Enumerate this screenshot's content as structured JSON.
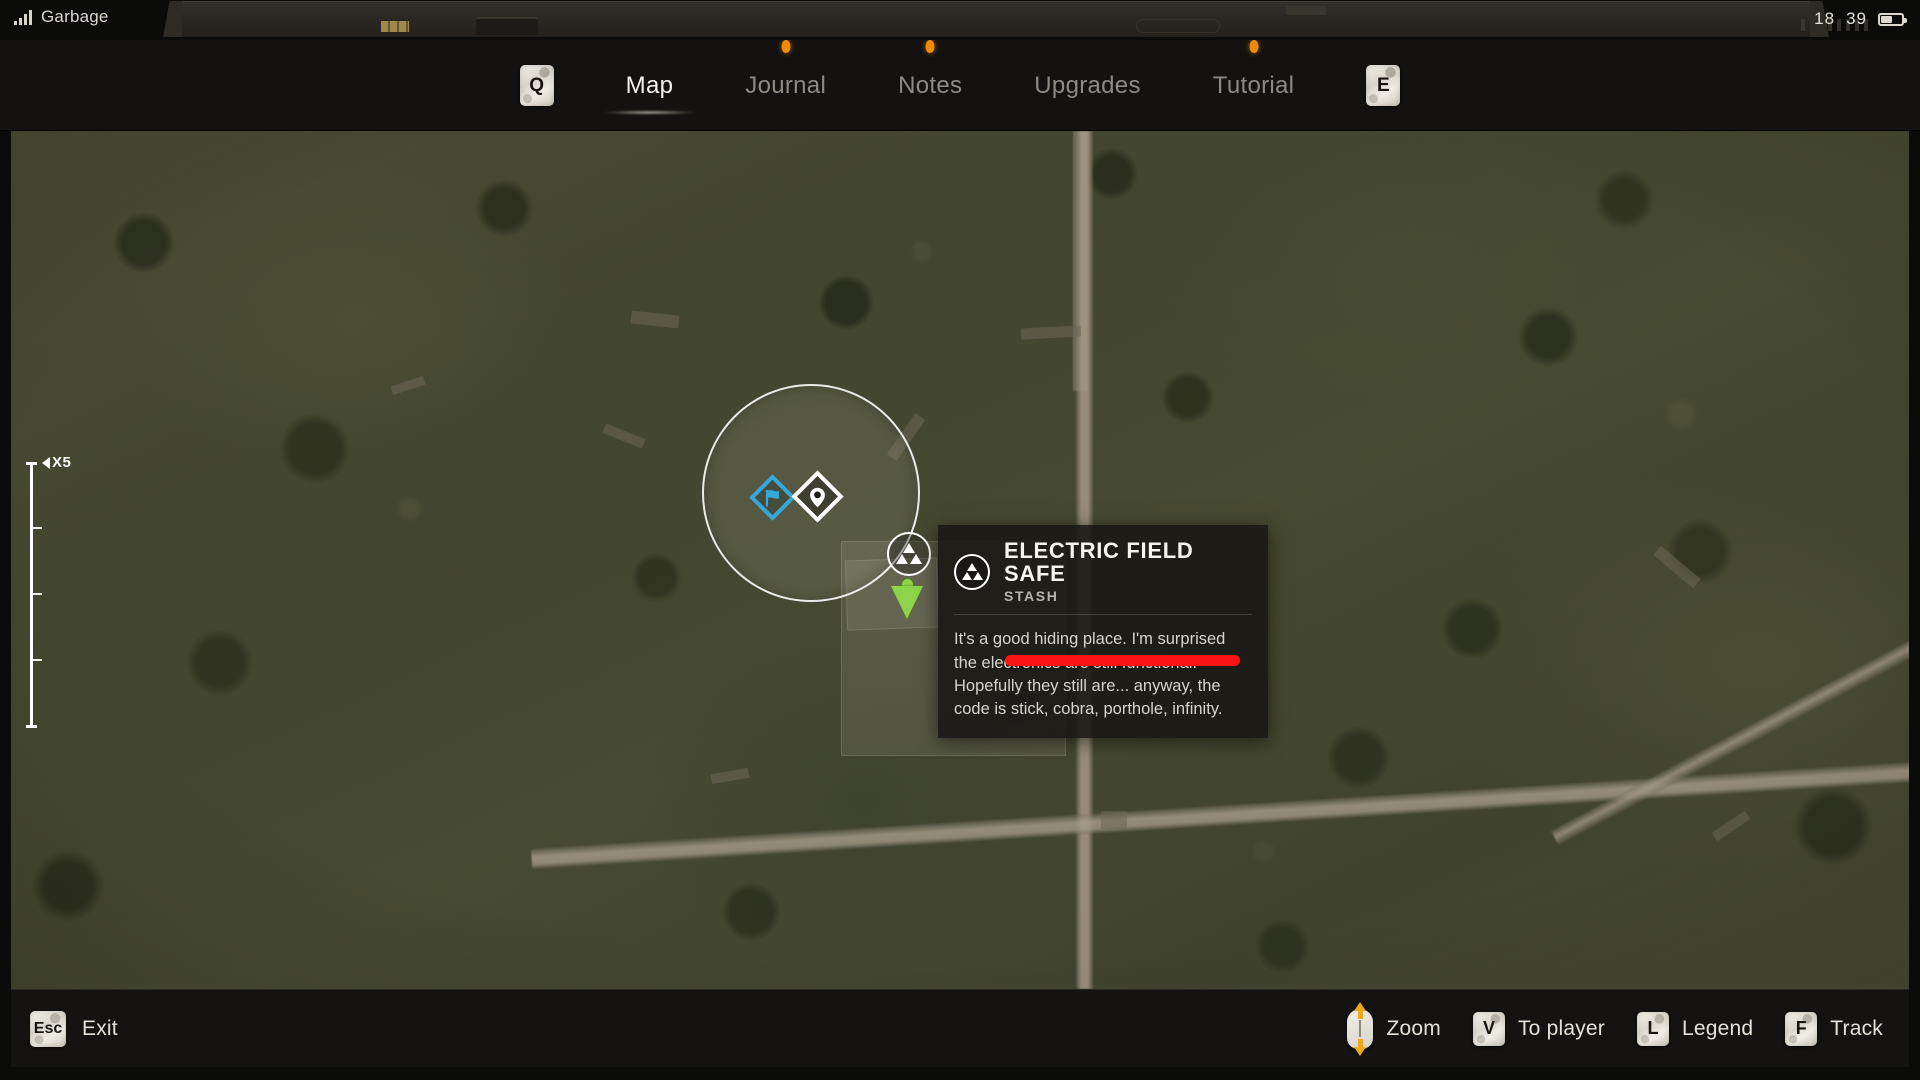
{
  "status_bar": {
    "signal_icon": "signal-bars-icon",
    "location_name": "Garbage",
    "time_hours": "18",
    "time_minutes": "39",
    "battery_icon": "battery-icon"
  },
  "nav": {
    "prev_key": "Q",
    "next_key": "E",
    "tabs": [
      {
        "label": "Map",
        "active": true,
        "notification": false
      },
      {
        "label": "Journal",
        "active": false,
        "notification": true
      },
      {
        "label": "Notes",
        "active": false,
        "notification": true
      },
      {
        "label": "Upgrades",
        "active": false,
        "notification": false
      },
      {
        "label": "Tutorial",
        "active": false,
        "notification": true
      }
    ]
  },
  "map": {
    "zoom_scale": {
      "label": "X5",
      "marker_icon": "left-triangle-icon"
    },
    "markers": [
      {
        "name": "search-area-circle",
        "icon": "circle-outline"
      },
      {
        "name": "marker-flag",
        "icon": "flag-diamond-icon",
        "color": "#35a7d9"
      },
      {
        "name": "marker-point-of-interest",
        "icon": "location-pin-diamond-icon",
        "color": "#ffffff"
      },
      {
        "name": "marker-stash",
        "icon": "stash-triangles-icon",
        "color": "#ffffff"
      },
      {
        "name": "marker-player",
        "icon": "player-arrow-icon",
        "color": "#8ed44a"
      }
    ]
  },
  "tooltip": {
    "icon": "stash-triangles-icon",
    "title": "ELECTRIC FIELD SAFE",
    "subtitle": "STASH",
    "description": "It's a good hiding place. I'm surprised the electronics are still functional. Hopefully they still are... anyway, the code is stick, cobra, porthole, infinity.",
    "highlight_color": "#fb1414"
  },
  "footer": {
    "exit": {
      "key": "Esc",
      "label": "Exit"
    },
    "actions": [
      {
        "key": "",
        "icon": "mouse-scroll-icon",
        "label": "Zoom"
      },
      {
        "key": "V",
        "icon": "keycap",
        "label": "To player"
      },
      {
        "key": "L",
        "icon": "keycap",
        "label": "Legend"
      },
      {
        "key": "F",
        "icon": "keycap",
        "label": "Track"
      }
    ]
  }
}
